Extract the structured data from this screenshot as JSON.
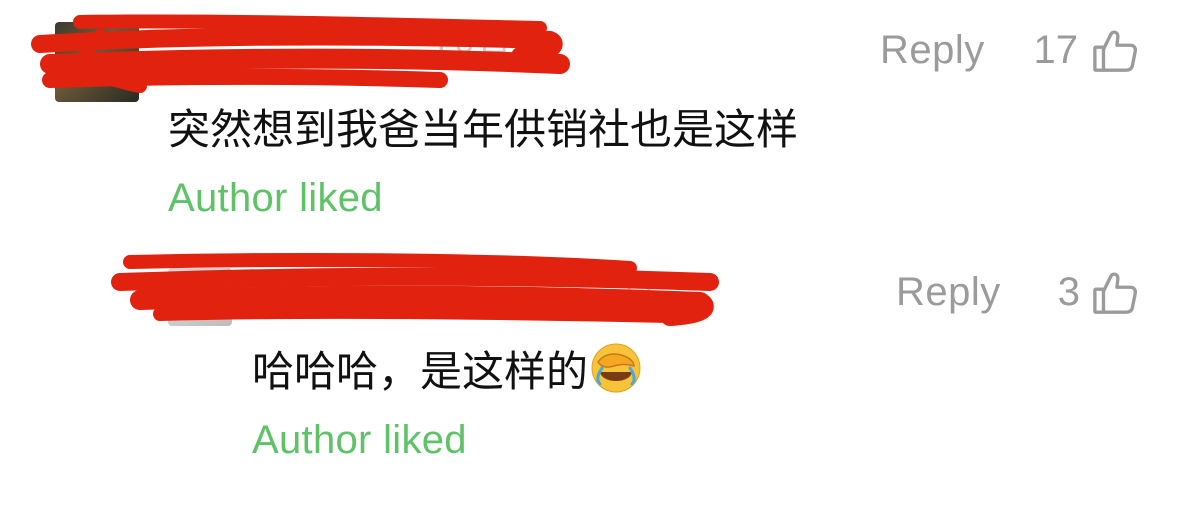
{
  "comments": [
    {
      "text": "突然想到我爸当年供销社也是这样",
      "reply_label": "Reply",
      "like_count": "17",
      "author_liked": "Author liked"
    },
    {
      "text": "哈哈哈，是这样的",
      "reply_label": "Reply",
      "like_count": "3",
      "author_liked": "Author liked",
      "emoji": "facepalm-laughing-emoji"
    }
  ],
  "colors": {
    "reply": "#9b9b9b",
    "author_liked": "#5ec267",
    "redaction": "#e0220f",
    "text": "#111111"
  },
  "icons": {
    "like": "thumbs-up-icon"
  }
}
